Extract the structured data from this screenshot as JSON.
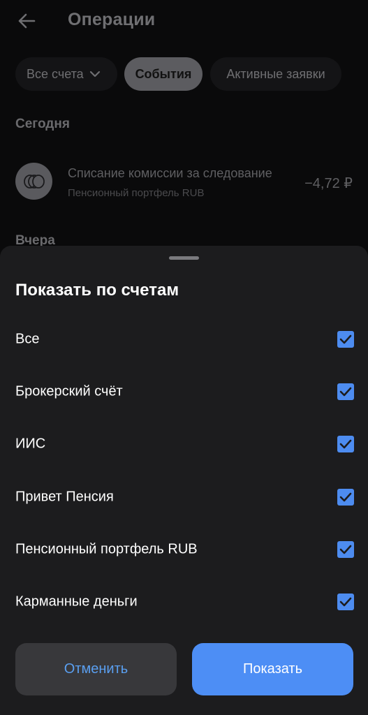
{
  "header": {
    "title": "Операции",
    "back_icon": "arrow-left-icon"
  },
  "filters": {
    "accounts_label": "Все счета",
    "events_label": "События",
    "active_orders_label": "Активные заявки"
  },
  "operations": {
    "today_label": "Сегодня",
    "yesterday_label": "Вчера",
    "items": [
      {
        "title": "Списание комиссии за следование",
        "subtitle": "Пенсионный портфель RUB",
        "amount": "−4,72 ₽"
      }
    ]
  },
  "sheet": {
    "title": "Показать по счетам",
    "accounts": [
      {
        "label": "Все",
        "checked": true
      },
      {
        "label": "Брокерский счёт",
        "checked": true
      },
      {
        "label": "ИИС",
        "checked": true
      },
      {
        "label": "Привет Пенсия",
        "checked": true
      },
      {
        "label": "Пенсионный портфель RUB",
        "checked": true
      },
      {
        "label": "Карманные деньги",
        "checked": true
      }
    ],
    "cancel_label": "Отменить",
    "show_label": "Показать"
  },
  "colors": {
    "accent": "#4d8ef5",
    "checkbox": "#4d8cf0",
    "sheet_bg": "#1c1c1e"
  }
}
